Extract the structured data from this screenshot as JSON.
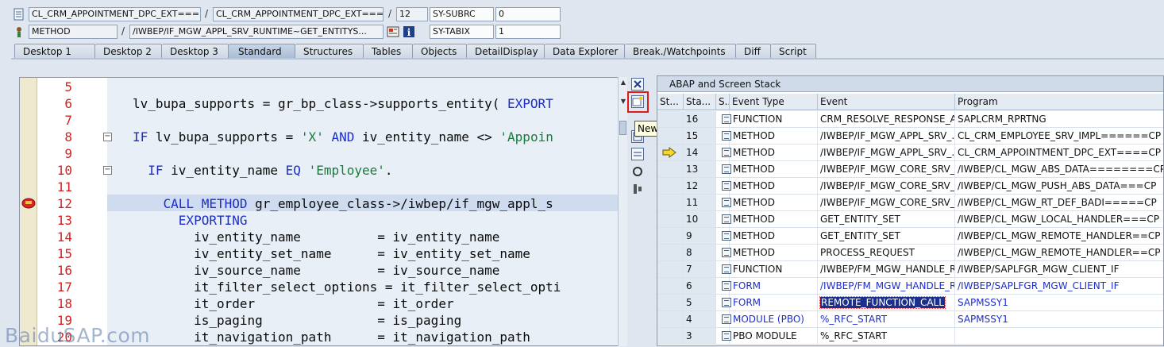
{
  "header": {
    "row1": {
      "field1": "CL_CRM_APPOINTMENT_DPC_EXT===...",
      "sep1": "/",
      "field2": "CL_CRM_APPOINTMENT_DPC_EXT===...",
      "sep2": "/",
      "field3": "12",
      "var_name": "SY-SUBRC",
      "var_value": "0"
    },
    "row2": {
      "field1": "METHOD",
      "sep1": "/",
      "field2": "/IWBEP/IF_MGW_APPL_SRV_RUNTIME~GET_ENTITYS...",
      "var_name": "SY-TABIX",
      "var_value": "1"
    }
  },
  "tabs": [
    {
      "label": "Desktop 1"
    },
    {
      "label": "Desktop 2"
    },
    {
      "label": "Desktop 3"
    },
    {
      "label": "Standard",
      "active": true
    },
    {
      "label": "Structures"
    },
    {
      "label": "Tables"
    },
    {
      "label": "Objects"
    },
    {
      "label": "DetailDisplay"
    },
    {
      "label": "Data Explorer"
    },
    {
      "label": "Break./Watchpoints"
    },
    {
      "label": "Diff"
    },
    {
      "label": "Script"
    }
  ],
  "editor": {
    "lines": [
      {
        "num": "5",
        "code": ""
      },
      {
        "num": "6",
        "code": "lv_bupa_supports = gr_bp_class->supports_entity( EXPORT"
      },
      {
        "num": "7",
        "code": ""
      },
      {
        "num": "8",
        "code": "IF lv_bupa_supports = 'X' AND iv_entity_name <> 'Appoin"
      },
      {
        "num": "9",
        "code": ""
      },
      {
        "num": "10",
        "code": "  IF iv_entity_name EQ 'Employee'."
      },
      {
        "num": "11",
        "code": ""
      },
      {
        "num": "12",
        "code": "    CALL METHOD gr_employee_class->/iwbep/if_mgw_appl_s"
      },
      {
        "num": "13",
        "code": "      EXPORTING"
      },
      {
        "num": "14",
        "code": "        iv_entity_name          = iv_entity_name"
      },
      {
        "num": "15",
        "code": "        iv_entity_set_name      = iv_entity_set_name"
      },
      {
        "num": "16",
        "code": "        iv_source_name          = iv_source_name"
      },
      {
        "num": "17",
        "code": "        it_filter_select_options = it_filter_select_opti"
      },
      {
        "num": "18",
        "code": "        it_order                = it_order"
      },
      {
        "num": "19",
        "code": "        is_paging               = is_paging"
      },
      {
        "num": "20",
        "code": "        it_navigation_path      = it_navigation_path"
      }
    ]
  },
  "tooltip": "New Tool",
  "stack": {
    "title": "ABAP and Screen Stack",
    "columns": [
      "St...",
      "Sta...",
      "S...",
      "Event Type",
      "Event",
      "Program"
    ],
    "rows": [
      {
        "level": "16",
        "type": "FUNCTION",
        "event": "CRM_RESOLVE_RESPONSE_A...",
        "program": "SAPLCRM_RPRTNG",
        "blue": false
      },
      {
        "level": "15",
        "type": "METHOD",
        "event": "/IWBEP/IF_MGW_APPL_SRV_...",
        "program": "CL_CRM_EMPLOYEE_SRV_IMPL======CP",
        "blue": false
      },
      {
        "level": "14",
        "type": "METHOD",
        "event": "/IWBEP/IF_MGW_APPL_SRV_...",
        "program": "CL_CRM_APPOINTMENT_DPC_EXT====CP",
        "blue": false,
        "current": true
      },
      {
        "level": "13",
        "type": "METHOD",
        "event": "/IWBEP/IF_MGW_CORE_SRV_...",
        "program": "/IWBEP/CL_MGW_ABS_DATA========CP",
        "blue": false
      },
      {
        "level": "12",
        "type": "METHOD",
        "event": "/IWBEP/IF_MGW_CORE_SRV_...",
        "program": "/IWBEP/CL_MGW_PUSH_ABS_DATA===CP",
        "blue": false
      },
      {
        "level": "11",
        "type": "METHOD",
        "event": "/IWBEP/IF_MGW_CORE_SRV_...",
        "program": "/IWBEP/CL_MGW_RT_DEF_BADI=====CP",
        "blue": false
      },
      {
        "level": "10",
        "type": "METHOD",
        "event": "GET_ENTITY_SET",
        "program": "/IWBEP/CL_MGW_LOCAL_HANDLER===CP",
        "blue": false
      },
      {
        "level": "9",
        "type": "METHOD",
        "event": "GET_ENTITY_SET",
        "program": "/IWBEP/CL_MGW_REMOTE_HANDLER==CP",
        "blue": false
      },
      {
        "level": "8",
        "type": "METHOD",
        "event": "PROCESS_REQUEST",
        "program": "/IWBEP/CL_MGW_REMOTE_HANDLER==CP",
        "blue": false
      },
      {
        "level": "7",
        "type": "FUNCTION",
        "event": "/IWBEP/FM_MGW_HANDLE_R...",
        "program": "/IWBEP/SAPLFGR_MGW_CLIENT_IF",
        "blue": false
      },
      {
        "level": "6",
        "type": "FORM",
        "event": "/IWBEP/FM_MGW_HANDLE_R...",
        "program": "/IWBEP/SAPLFGR_MGW_CLIENT_IF",
        "blue": true
      },
      {
        "level": "5",
        "type": "FORM",
        "event": "REMOTE_FUNCTION_CALL",
        "program": "SAPMSSY1",
        "blue": true,
        "selected": true
      },
      {
        "level": "4",
        "type": "MODULE (PBO)",
        "event": "%_RFC_START",
        "program": "SAPMSSY1",
        "blue": true
      },
      {
        "level": "3",
        "type": "PBO MODULE",
        "event": "%_RFC_START",
        "program": "",
        "blue": false
      }
    ]
  },
  "watermark": "BaiduSAP.com"
}
